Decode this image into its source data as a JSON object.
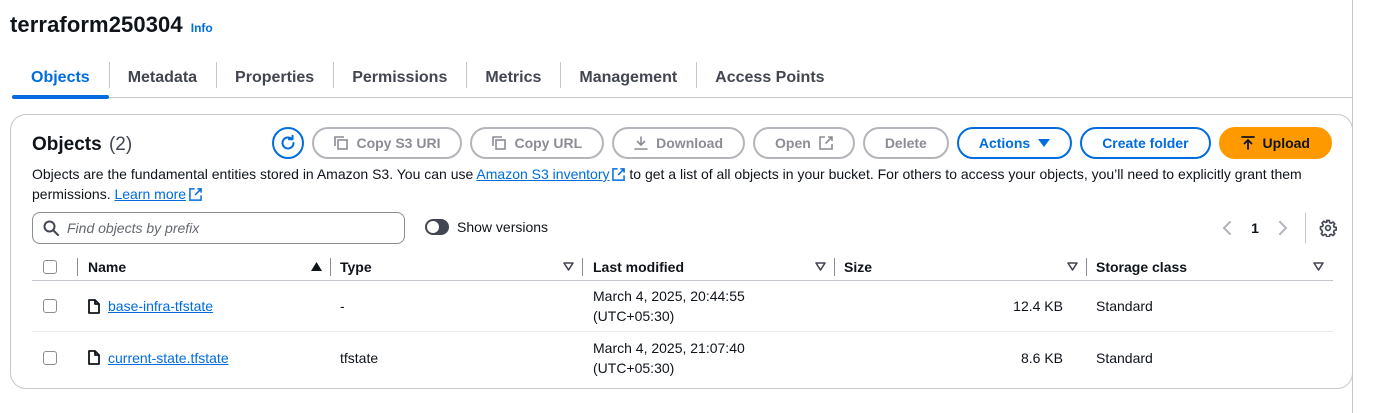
{
  "header": {
    "title": "terraform250304",
    "info_label": "Info"
  },
  "tabs": [
    {
      "label": "Objects",
      "active": true
    },
    {
      "label": "Metadata"
    },
    {
      "label": "Properties"
    },
    {
      "label": "Permissions"
    },
    {
      "label": "Metrics"
    },
    {
      "label": "Management"
    },
    {
      "label": "Access Points"
    }
  ],
  "objects_panel": {
    "title": "Objects",
    "count": "(2)",
    "toolbar": {
      "refresh_icon": "refresh-icon",
      "copy_s3_uri": "Copy S3 URI",
      "copy_url": "Copy URL",
      "download": "Download",
      "open": "Open",
      "delete": "Delete",
      "actions": "Actions",
      "create_folder": "Create folder",
      "upload": "Upload"
    },
    "description": {
      "part1": "Objects are the fundamental entities stored in Amazon S3. You can use ",
      "inventory_link": "Amazon S3 inventory",
      "part2": " to get a list of all objects in your bucket. For others to access your objects, you’ll need to explicitly grant them permissions. ",
      "learn_more": "Learn more"
    },
    "search": {
      "placeholder": "Find objects by prefix",
      "value": ""
    },
    "show_versions": {
      "label": "Show versions",
      "enabled": false
    },
    "pagination": {
      "current_page": "1"
    },
    "table": {
      "columns": [
        "Name",
        "Type",
        "Last modified",
        "Size",
        "Storage class"
      ],
      "rows": [
        {
          "name": "base-infra-tfstate",
          "type": "-",
          "last_modified_line1": "March 4, 2025, 20:44:55",
          "last_modified_line2": "(UTC+05:30)",
          "size": "12.4 KB",
          "storage_class": "Standard"
        },
        {
          "name": "current-state.tfstate",
          "type": "tfstate",
          "last_modified_line1": "March 4, 2025, 21:07:40",
          "last_modified_line2": "(UTC+05:30)",
          "size": "8.6 KB",
          "storage_class": "Standard"
        }
      ]
    }
  },
  "colors": {
    "accent": "#006ce0",
    "upload": "#ff9900",
    "disabled": "#8c8c94",
    "border": "#c6c6cd"
  }
}
